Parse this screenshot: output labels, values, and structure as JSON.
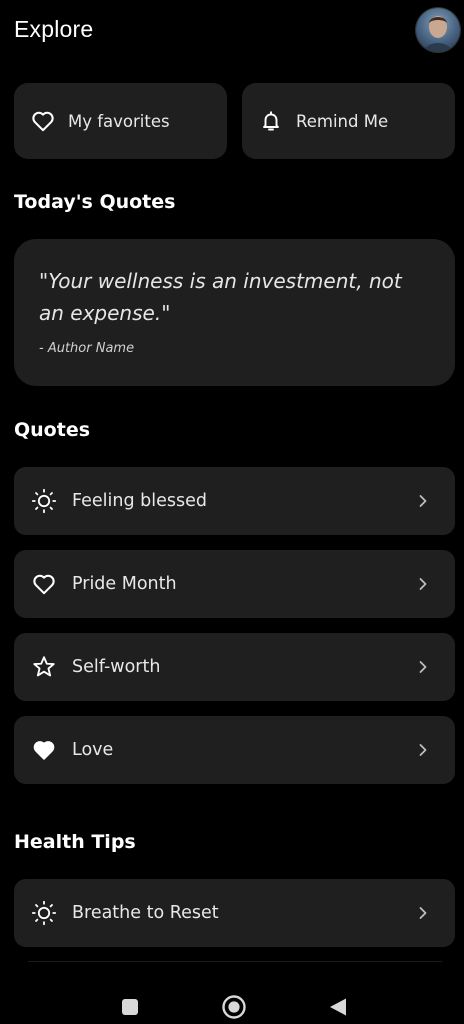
{
  "header": {
    "title": "Explore",
    "avatar_icon": "user-avatar"
  },
  "actions": {
    "favorites": {
      "label": "My favorites",
      "icon": "heart-outline-icon"
    },
    "remind": {
      "label": "Remind Me",
      "icon": "bell-icon"
    }
  },
  "today": {
    "section_title": "Today's Quotes",
    "quote": "\"Your wellness is an investment, not an expense.\"",
    "author": "- Author Name"
  },
  "quotes": {
    "section_title": "Quotes",
    "items": [
      {
        "label": "Feeling blessed",
        "icon": "sun-icon"
      },
      {
        "label": "Pride Month",
        "icon": "heart-outline-icon"
      },
      {
        "label": "Self-worth",
        "icon": "star-outline-icon"
      },
      {
        "label": "Love",
        "icon": "heart-filled-icon"
      }
    ]
  },
  "health": {
    "section_title": "Health Tips",
    "items": [
      {
        "label": "Breathe to Reset",
        "icon": "sun-icon"
      }
    ]
  },
  "nav": {
    "recents": "square-icon",
    "home": "circle-icon",
    "back": "triangle-back-icon"
  },
  "colors": {
    "background": "#000000",
    "card": "#1f1f1f",
    "text": "#ffffff"
  }
}
